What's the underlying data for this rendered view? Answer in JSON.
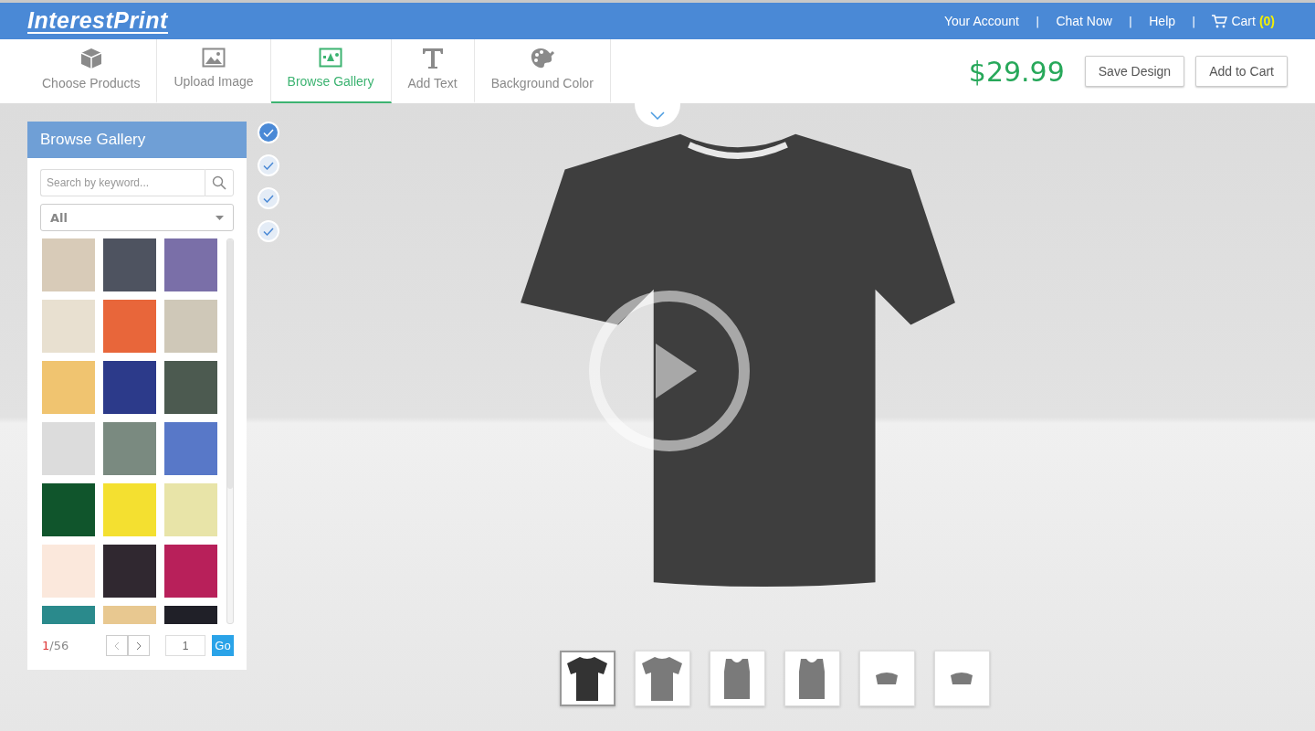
{
  "header": {
    "logo": "InterestPrint",
    "links": [
      {
        "label": "Your Account",
        "separator": "|"
      },
      {
        "label": "Chat Now",
        "separator": "|"
      },
      {
        "label": "Help",
        "separator": "|"
      }
    ],
    "cart": {
      "label": "Cart",
      "count": "(0)"
    }
  },
  "tools": [
    {
      "label": "Choose Products",
      "kind": "cube",
      "selected": false
    },
    {
      "label": "Upload Image",
      "kind": "image",
      "selected": false
    },
    {
      "label": "Browse Gallery",
      "kind": "gallery",
      "selected": true
    },
    {
      "label": "Add Text",
      "kind": "text",
      "selected": false
    },
    {
      "label": "Background Color",
      "kind": "palette",
      "selected": false
    }
  ],
  "price": "$29.99",
  "actions": [
    {
      "label": "Save Design"
    },
    {
      "label": "Add to Cart"
    }
  ],
  "gallery": {
    "title": "Browse Gallery",
    "search": {
      "placeholder": "Search by keyword..."
    },
    "category": "All",
    "tiles": [
      {
        "color": "#d8cbb8"
      },
      {
        "color": "#4e5360"
      },
      {
        "color": "#7a6fa8"
      },
      {
        "color": "#e8e0d0"
      },
      {
        "color": "#e8663a"
      },
      {
        "color": "#cfc8b8"
      },
      {
        "color": "#f0c470"
      },
      {
        "color": "#2c3a8a"
      },
      {
        "color": "#4c5a50"
      },
      {
        "color": "#dcdcdc"
      },
      {
        "color": "#7a8a80"
      },
      {
        "color": "#5878c8"
      },
      {
        "color": "#10552c"
      },
      {
        "color": "#f4e030"
      },
      {
        "color": "#e8e4a8"
      },
      {
        "color": "#fbe8dc"
      },
      {
        "color": "#302830"
      },
      {
        "color": "#b8205a"
      },
      {
        "color": "#2a8a8c"
      },
      {
        "color": "#e8c890"
      },
      {
        "color": "#202028"
      }
    ],
    "page_current": "1",
    "page_total": "/56",
    "page_input": "1",
    "go": "Go"
  },
  "layers": [
    {
      "selected": true
    },
    {
      "selected": false
    },
    {
      "selected": false
    },
    {
      "selected": false
    }
  ],
  "views": [
    {
      "kind": "tee",
      "selected": true
    },
    {
      "kind": "tee",
      "selected": false
    },
    {
      "kind": "tank",
      "selected": false
    },
    {
      "kind": "tank",
      "selected": false
    },
    {
      "kind": "sleeve",
      "selected": false
    },
    {
      "kind": "sleeve",
      "selected": false
    }
  ]
}
